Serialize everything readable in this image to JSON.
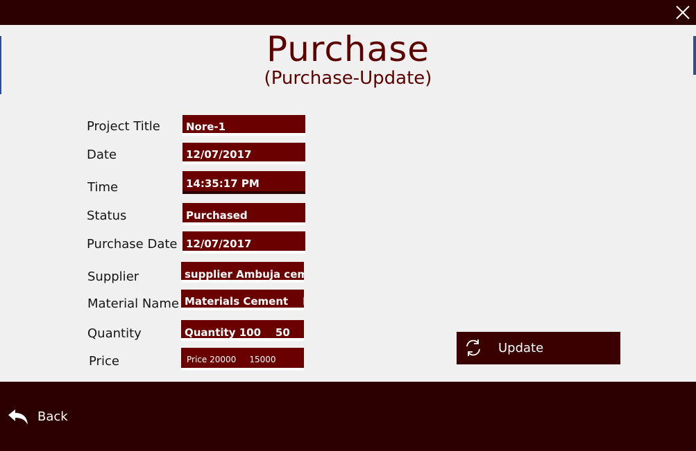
{
  "window": {
    "close_icon": "close-icon"
  },
  "header": {
    "title": "Purchase",
    "subtitle": "(Purchase-Update)"
  },
  "form": {
    "fields": [
      {
        "label": "Project Title",
        "value": "Nore-1"
      },
      {
        "label": "Date",
        "value": "12/07/2017"
      },
      {
        "label": "Time",
        "value": "14:35:17 PM"
      },
      {
        "label": "Status",
        "value": "Purchased"
      },
      {
        "label": "Purchase Date",
        "value": "12/07/2017"
      },
      {
        "label": "Supplier",
        "value": "supplier Ambuja cem"
      },
      {
        "label": "Material Name",
        "value": "Materials Cement    Pe"
      },
      {
        "label": "Quantity",
        "value": "Quantity 100    50"
      },
      {
        "label": "Price",
        "value": "Price 20000     15000"
      }
    ]
  },
  "actions": {
    "update_label": "Update",
    "update_icon": "refresh-icon",
    "back_label": "Back",
    "back_icon": "back-arrow-icon"
  },
  "colors": {
    "bar": "#2d0000",
    "field_bg": "#6b0000",
    "title": "#5c0000",
    "button": "#3a0000",
    "background": "#f0f0f0"
  }
}
